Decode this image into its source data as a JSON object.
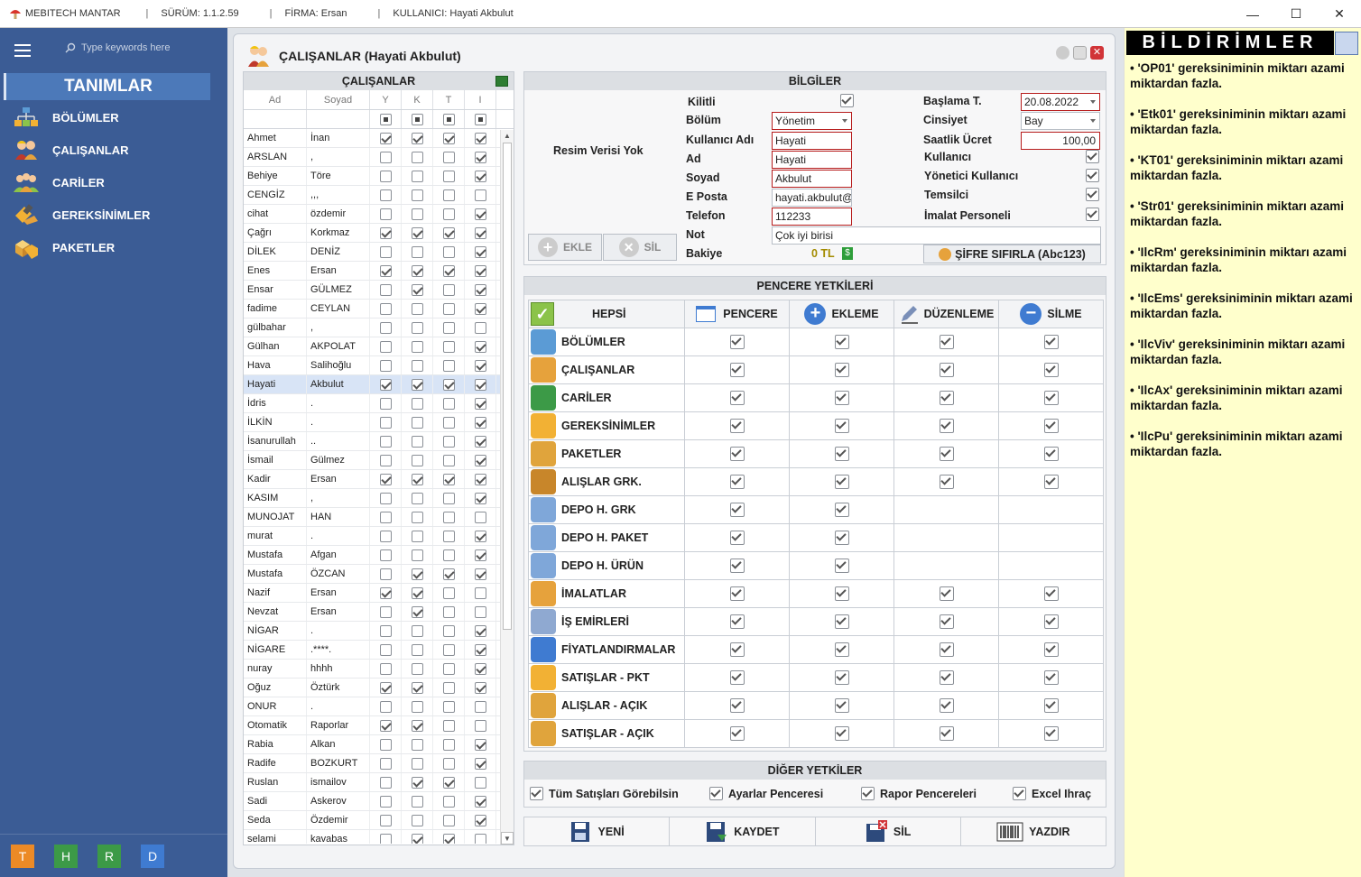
{
  "titlebar": {
    "app": "MEBITECH MANTAR",
    "version": "SÜRÜM: 1.1.2.59",
    "firm": "FİRMA: Ersan",
    "user": "KULLANICI: Hayati Akbulut",
    "sep": "|"
  },
  "sidebar": {
    "search_placeholder": "Type keywords here",
    "section": "TANIMLAR",
    "items": [
      {
        "label": "BÖLÜMLER"
      },
      {
        "label": "ÇALIŞANLAR"
      },
      {
        "label": "CARİLER"
      },
      {
        "label": "GEREKSİNİMLER"
      },
      {
        "label": "PAKETLER"
      }
    ],
    "tabs": [
      "T",
      "H",
      "R",
      "D"
    ]
  },
  "form": {
    "title": "ÇALIŞANLAR (Hayati Akbulut)"
  },
  "employees": {
    "header": "ÇALIŞANLAR",
    "columns": [
      "Ad",
      "Soyad",
      "Y",
      "K",
      "T",
      "I"
    ],
    "rows": [
      [
        "Ahmet",
        "İnan",
        1,
        1,
        1,
        1
      ],
      [
        "ARSLAN",
        ",",
        0,
        0,
        0,
        1
      ],
      [
        "Behiye",
        "Töre",
        0,
        0,
        0,
        1
      ],
      [
        "CENGİZ",
        ",,,",
        0,
        0,
        0,
        0
      ],
      [
        "cihat",
        "özdemir",
        0,
        0,
        0,
        1
      ],
      [
        "Çağrı",
        "Korkmaz",
        1,
        1,
        1,
        1
      ],
      [
        "DİLEK",
        "DENİZ",
        0,
        0,
        0,
        1
      ],
      [
        "Enes",
        "Ersan",
        1,
        1,
        1,
        1
      ],
      [
        "Ensar",
        "GÜLMEZ",
        0,
        1,
        0,
        1
      ],
      [
        "fadime",
        "CEYLAN",
        0,
        0,
        0,
        1
      ],
      [
        "gülbahar",
        ",",
        0,
        0,
        0,
        0
      ],
      [
        "Gülhan",
        "AKPOLAT",
        0,
        0,
        0,
        1
      ],
      [
        "Hava",
        "Salihoğlu",
        0,
        0,
        0,
        1
      ],
      [
        "Hayati",
        "Akbulut",
        1,
        1,
        1,
        1
      ],
      [
        "İdris",
        ".",
        0,
        0,
        0,
        1
      ],
      [
        "İLKİN",
        ".",
        0,
        0,
        0,
        1
      ],
      [
        "İsanurullah",
        "..",
        0,
        0,
        0,
        1
      ],
      [
        "İsmail",
        "Gülmez",
        0,
        0,
        0,
        1
      ],
      [
        "Kadir",
        "Ersan",
        1,
        1,
        1,
        1
      ],
      [
        "KASIM",
        ",",
        0,
        0,
        0,
        1
      ],
      [
        "MUNOJAT",
        "HAN",
        0,
        0,
        0,
        0
      ],
      [
        "murat",
        ".",
        0,
        0,
        0,
        1
      ],
      [
        "Mustafa",
        "Afgan",
        0,
        0,
        0,
        1
      ],
      [
        "Mustafa",
        "ÖZCAN",
        0,
        1,
        1,
        1
      ],
      [
        "Nazif",
        "Ersan",
        1,
        1,
        0,
        0
      ],
      [
        "Nevzat",
        "Ersan",
        0,
        1,
        0,
        0
      ],
      [
        "NİGAR",
        ".",
        0,
        0,
        0,
        1
      ],
      [
        "NİGARE",
        ".****.",
        0,
        0,
        0,
        1
      ],
      [
        "nuray",
        "hhhh",
        0,
        0,
        0,
        1
      ],
      [
        "Oğuz",
        "Öztürk",
        1,
        1,
        0,
        1
      ],
      [
        "ONUR",
        ".",
        0,
        0,
        0,
        0
      ],
      [
        "Otomatik",
        "Raporlar",
        1,
        1,
        0,
        0
      ],
      [
        "Rabia",
        "Alkan",
        0,
        0,
        0,
        1
      ],
      [
        "Radife",
        "BOZKURT",
        0,
        0,
        0,
        1
      ],
      [
        "Ruslan",
        "ismailov",
        0,
        1,
        1,
        0
      ],
      [
        "Sadi",
        "Askerov",
        0,
        0,
        0,
        1
      ],
      [
        "Seda",
        "Özdemir",
        0,
        0,
        0,
        1
      ],
      [
        "selami",
        "kavabas",
        0,
        1,
        1,
        0
      ]
    ],
    "selected_index": 13
  },
  "info": {
    "header": "BİLGİLER",
    "no_image": "Resim Verisi Yok",
    "add_label": "EKLE",
    "delete_label": "SİL",
    "kilitli": "Kilitli",
    "bolum": "Bölüm",
    "bolum_value": "Yönetim",
    "kullanici_adi": "Kullanıcı Adı",
    "kullanici_adi_value": "Hayati",
    "ad": "Ad",
    "ad_value": "Hayati",
    "soyad": "Soyad",
    "soyad_value": "Akbulut",
    "eposta": "E Posta",
    "eposta_value": "hayati.akbulut@",
    "telefon": "Telefon",
    "telefon_value": "112233",
    "not": "Not",
    "not_value": "Çok iyi birisi",
    "bakiye": "Bakiye",
    "bakiye_value": "0 TL",
    "baslama": "Başlama T.",
    "baslama_value": "20.08.2022",
    "cinsiyet": "Cinsiyet",
    "cinsiyet_value": "Bay",
    "ucret": "Saatlik Ücret",
    "ucret_value": "100,00",
    "kullanici": "Kullanıcı",
    "yonetici": "Yönetici Kullanıcı",
    "temsilci": "Temsilci",
    "imalat": "İmalat Personeli",
    "reset_label": "ŞİFRE SIFIRLA (Abc123)"
  },
  "permissions": {
    "header": "PENCERE YETKİLERİ",
    "all": "HEPSİ",
    "cols": [
      "PENCERE",
      "EKLEME",
      "DÜZENLEME",
      "SİLME"
    ],
    "rows": [
      {
        "label": "BÖLÜMLER",
        "v": [
          1,
          1,
          1,
          1
        ]
      },
      {
        "label": "ÇALIŞANLAR",
        "v": [
          1,
          1,
          1,
          1
        ]
      },
      {
        "label": "CARİLER",
        "v": [
          1,
          1,
          1,
          1
        ]
      },
      {
        "label": "GEREKSİNİMLER",
        "v": [
          1,
          1,
          1,
          1
        ]
      },
      {
        "label": "PAKETLER",
        "v": [
          1,
          1,
          1,
          1
        ]
      },
      {
        "label": "ALIŞLAR GRK.",
        "v": [
          1,
          1,
          1,
          1
        ]
      },
      {
        "label": "DEPO H. GRK",
        "v": [
          1,
          1,
          0,
          0
        ]
      },
      {
        "label": "DEPO H. PAKET",
        "v": [
          1,
          1,
          0,
          0
        ]
      },
      {
        "label": "DEPO H. ÜRÜN",
        "v": [
          1,
          1,
          0,
          0
        ]
      },
      {
        "label": "İMALATLAR",
        "v": [
          1,
          1,
          1,
          1
        ]
      },
      {
        "label": "İŞ EMİRLERİ",
        "v": [
          1,
          1,
          1,
          1
        ]
      },
      {
        "label": "FİYATLANDIRMALAR",
        "v": [
          1,
          1,
          1,
          1
        ]
      },
      {
        "label": "SATIŞLAR - PKT",
        "v": [
          1,
          1,
          1,
          1
        ]
      },
      {
        "label": "ALIŞLAR - AÇIK",
        "v": [
          1,
          1,
          1,
          1
        ]
      },
      {
        "label": "SATIŞLAR - AÇIK",
        "v": [
          1,
          1,
          1,
          1
        ]
      }
    ]
  },
  "other": {
    "header": "DİĞER YETKİLER",
    "items": [
      "Tüm Satışları Görebilsin",
      "Ayarlar Penceresi",
      "Rapor Pencereleri",
      "Excel Ihraç"
    ]
  },
  "actions": [
    "YENİ",
    "KAYDET",
    "SİL",
    "YAZDIR"
  ],
  "notifications": {
    "header": "BİLDİRİMLER",
    "items": [
      "• 'OP01' gereksiniminin miktarı azami miktardan fazla.",
      "• 'Etk01' gereksiniminin miktarı azami miktardan fazla.",
      "• 'KT01' gereksiniminin miktarı azami miktardan fazla.",
      "• 'Str01' gereksiniminin miktarı azami miktardan fazla.",
      "• 'IlcRm' gereksiniminin miktarı azami miktardan fazla.",
      "• 'IlcEms' gereksiniminin miktarı azami miktardan fazla.",
      "• 'IlcViv' gereksiniminin miktarı azami miktardan fazla.",
      "• 'IlcAx' gereksiniminin miktarı azami miktardan fazla.",
      "• 'IlcPu' gereksiniminin miktarı azami miktardan fazla."
    ]
  },
  "colors": {
    "sidebar": "#3b5c95",
    "accent": "#4c79b9",
    "required_border": "#b71c1c",
    "notif_bg": "#ffffcc"
  }
}
